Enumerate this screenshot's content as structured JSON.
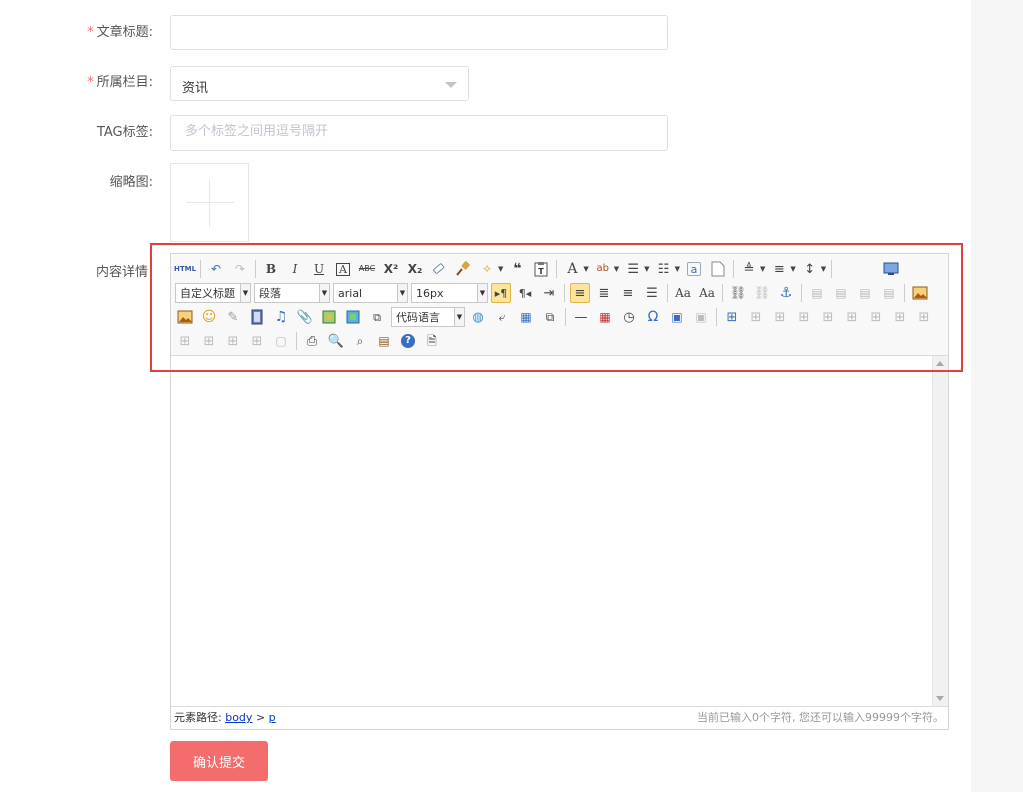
{
  "form": {
    "title_label": "文章标题:",
    "title_value": "",
    "category_label": "所属栏目:",
    "category_value": "资讯",
    "tag_label": "TAG标签:",
    "tag_placeholder": "多个标签之间用逗号隔开",
    "thumb_label": "缩略图:",
    "content_label": "内容详情",
    "required_mark": "*"
  },
  "editor": {
    "html_icon_text": "HTML",
    "custom_title_combo": "自定义标题",
    "paragraph_combo": "段落",
    "font_family_combo": "arial",
    "font_size_combo": "16px",
    "code_language_combo": "代码语言",
    "element_path_label": "元素路径:",
    "path_body": "body",
    "path_sep": ">",
    "path_p": "p",
    "wordcount_text": "当前已输入0个字符, 您还可以输入99999个字符。"
  },
  "submit_label": "确认提交",
  "colors": {
    "accent": "#f36d6d",
    "required": "#f56c6c",
    "highlight_outline": "#e04040"
  }
}
